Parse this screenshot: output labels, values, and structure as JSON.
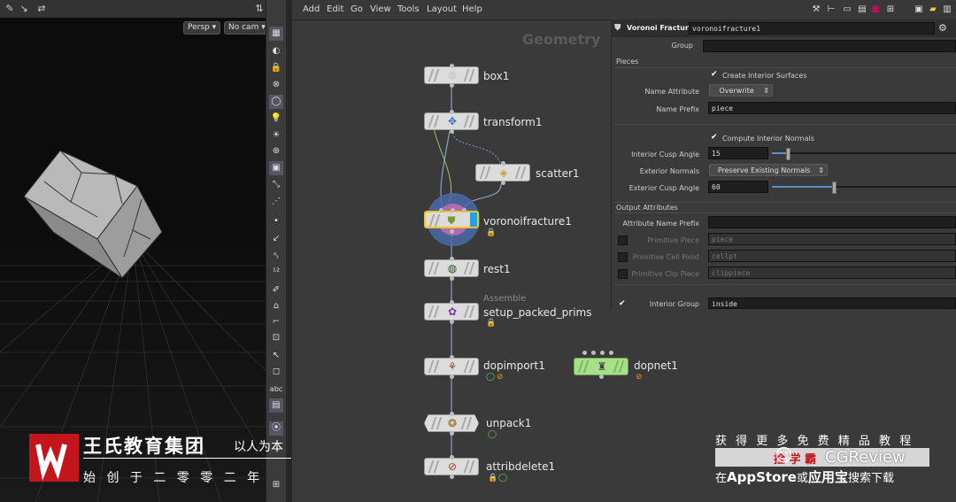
{
  "viewport": {
    "camera_view": "Persp",
    "camera": "No cam"
  },
  "menubar": {
    "items": [
      "Add",
      "Edit",
      "Go",
      "View",
      "Tools",
      "Layout",
      "Help"
    ]
  },
  "network": {
    "context_label": "Geometry",
    "nodes": {
      "box1": {
        "name": "box1",
        "icon": "box-icon"
      },
      "transform1": {
        "name": "transform1",
        "icon": "transform-icon"
      },
      "scatter1": {
        "name": "scatter1",
        "icon": "scatter-icon"
      },
      "voronoifracture1": {
        "name": "voronoifracture1",
        "icon": "voronoi-fracture-icon"
      },
      "rest1": {
        "name": "rest1",
        "icon": "rest-icon"
      },
      "setup_packed_prims": {
        "name": "setup_packed_prims",
        "tag": "Assemble",
        "icon": "assemble-icon"
      },
      "dopimport1": {
        "name": "dopimport1",
        "icon": "dop-import-icon"
      },
      "dopnet1": {
        "name": "dopnet1",
        "icon": "dopnet-icon"
      },
      "unpack1": {
        "name": "unpack1",
        "icon": "unpack-icon"
      },
      "attribdelete1": {
        "name": "attribdelete1",
        "icon": "attrib-delete-icon"
      }
    },
    "colors": {
      "selected": "#f5c518",
      "display_flag": "#1fa3e8",
      "dopnet": "#a6e08a"
    }
  },
  "params": {
    "node_type": "Voronoi Fracture",
    "node_name": "voronoifracture1",
    "group_label": "Group",
    "group_value": "",
    "pieces_section": "Pieces",
    "create_interior_surfaces": "Create Interior Surfaces",
    "name_attribute_label": "Name Attribute",
    "name_attribute_value": "Overwrite",
    "name_prefix_label": "Name Prefix",
    "name_prefix_value": "piece",
    "compute_interior_normals": "Compute Interior Normals",
    "interior_cusp_label": "Interior Cusp Angle",
    "interior_cusp_value": "15",
    "interior_cusp_fraction": 0.083,
    "exterior_normals_label": "Exterior Normals",
    "exterior_normals_value": "Preserve Existing Normals",
    "exterior_cusp_label": "Exterior Cusp Angle",
    "exterior_cusp_value": "60",
    "exterior_cusp_fraction": 0.333,
    "output_section": "Output Attributes",
    "attr_name_prefix_label": "Attribute Name Prefix",
    "attr_name_prefix_value": "",
    "prim_piece_label": "Primitive Piece",
    "prim_piece_value": "piece",
    "prim_cell_label": "Primitive Cell Point",
    "prim_cell_value": "cellpt",
    "prim_clip_label": "Primitive Clip Piece",
    "prim_clip_value": "clippiece",
    "interior_group_label": "Interior Group",
    "interior_group_value": "inside"
  },
  "watermark": {
    "org_name": "王氏教育集团",
    "motto": "以人为本",
    "founded": "始 创 于 二 零 零 二 年",
    "promo_line1": "获 得 更 多 免 费 精 品 教 程",
    "promo_brand_cn": "捡 学 霸",
    "promo_brand_en": "CGReview",
    "promo_line3_prefix": "在",
    "promo_appstore": "AppStore",
    "promo_or": "或",
    "promo_yingyongbao": "应用宝",
    "promo_suffix": "搜索下载"
  }
}
